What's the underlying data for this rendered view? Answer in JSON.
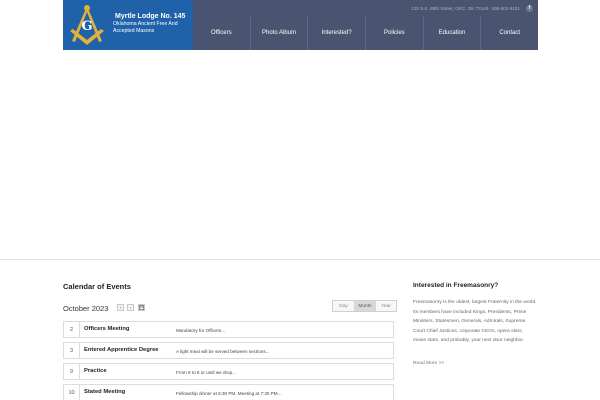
{
  "header": {
    "logo_title": "Myrtle Lodge No. 145",
    "logo_subtitle": "Oklahoma Ancient Free And Accepted Masons",
    "logo_letter": "G",
    "contact": {
      "address": "125 S.E. 89th Street, OKC, OK 73149",
      "phone": "405-602-6101",
      "facebook_glyph": "f"
    },
    "nav": [
      "Officers",
      "Photo Album",
      "Interested?",
      "Policies",
      "Education",
      "Contact"
    ]
  },
  "calendar": {
    "title": "Calendar of Events",
    "month": "October 2023",
    "prev_glyph": "‹",
    "next_glyph": "›",
    "views": [
      "Day",
      "Month",
      "Year"
    ],
    "active_view": "Month",
    "events": [
      {
        "day": "2",
        "name": "Officers Meeting",
        "desc": "Mandatory for Officers..."
      },
      {
        "day": "3",
        "name": "Entered Apprentice Degree",
        "desc": "A light meal will be served between sections..."
      },
      {
        "day": "9",
        "name": "Practice",
        "desc": "From 6 to 8 or until we drop..."
      },
      {
        "day": "10",
        "name": "Stated Meeting",
        "desc": "Fellowship dinner at 6:30 PM. Meeting at 7:30 PM..."
      }
    ]
  },
  "sidebar": {
    "title": "Interested in Freemasonry?",
    "text": "Freemasonry is the oldest, largest Fraternity in the world. Its members have included Kings, Presidents, Prime Ministers, Statesmen, Generals, Admirals, Supreme Court Chief Justices, corporate CEOs, opera stars, movie stars, and probably, your next door neighbor.",
    "read_more": "Read More >>"
  },
  "colors": {
    "header_bg": "#4a5470",
    "logo_bg": "#1f62a9",
    "emblem_gold": "#e0b23a"
  }
}
